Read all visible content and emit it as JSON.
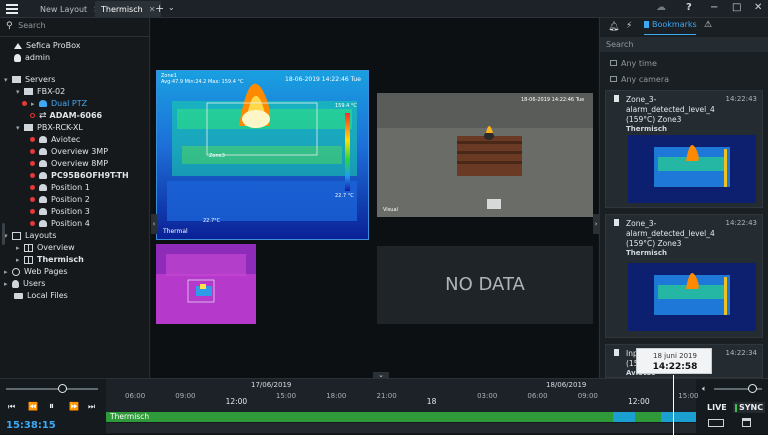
{
  "tabs": [
    {
      "label": "New Layout"
    },
    {
      "label": "Thermisch"
    }
  ],
  "left": {
    "search_placeholder": "Search",
    "site": "Sefica ProBox",
    "user": "admin",
    "servers_label": "Servers",
    "server1": "FBX-02",
    "server1_items": [
      "Dual PTZ",
      "ADAM-6066"
    ],
    "server2": "PBX-RCK-XL",
    "server2_items": [
      "Aviotec",
      "Overview 3MP",
      "Overview 8MP",
      "PC95B6OFH9T-TH",
      "Position 1",
      "Position 2",
      "Position 3",
      "Position 4"
    ],
    "layouts_label": "Layouts",
    "layouts_items": [
      "Overview",
      "Thermisch"
    ],
    "web_pages": "Web Pages",
    "users": "Users",
    "local_files": "Local Files"
  },
  "center": {
    "thermal_zone": "Zone1",
    "thermal_stats": "Avg:47.9 Min:24.2 Max: 159.4 °C",
    "thermal_datetime": "18-06-2019 14:22:46 Tue",
    "thermal_label": "Thermal",
    "scale_max": "159.4 °C",
    "scale_min": "22.7 °C",
    "bottom_temp": "22.7°C",
    "zone3_label": "Zone3",
    "visual_datetime": "18-06-2019 14:22:46 Tue",
    "visual_label": "Visual",
    "no_data": "NO DATA"
  },
  "right": {
    "tab_bookmarks": "Bookmarks",
    "search_placeholder": "Search",
    "filter_time": "Any time",
    "filter_camera": "Any camera",
    "cards": [
      {
        "title": "Zone_3-alarm_detected_level_4 (159°C) Zone3",
        "time": "14:22:43",
        "camera": "Thermisch"
      },
      {
        "title": "Zone_3-alarm_detected_level_4 (159°C) Zone3",
        "time": "14:22:43",
        "camera": "Thermisch"
      },
      {
        "title": "Inp (159",
        "time": "14:22:34",
        "camera": "Aviotec"
      }
    ]
  },
  "timeline": {
    "date1": "17/06/2019",
    "date2": "18/06/2019",
    "ticks": [
      "06:00",
      "09:00",
      "12:00",
      "15:00",
      "18:00",
      "21:00",
      "18",
      "03:00",
      "06:00",
      "09:00",
      "12:00",
      "15:00"
    ],
    "track_label": "Thermisch",
    "tooltip_date": "18 juni 2019",
    "tooltip_time": "14:22:58",
    "current_time": "15:38:15",
    "live": "LIVE",
    "sync": "SYNC"
  }
}
